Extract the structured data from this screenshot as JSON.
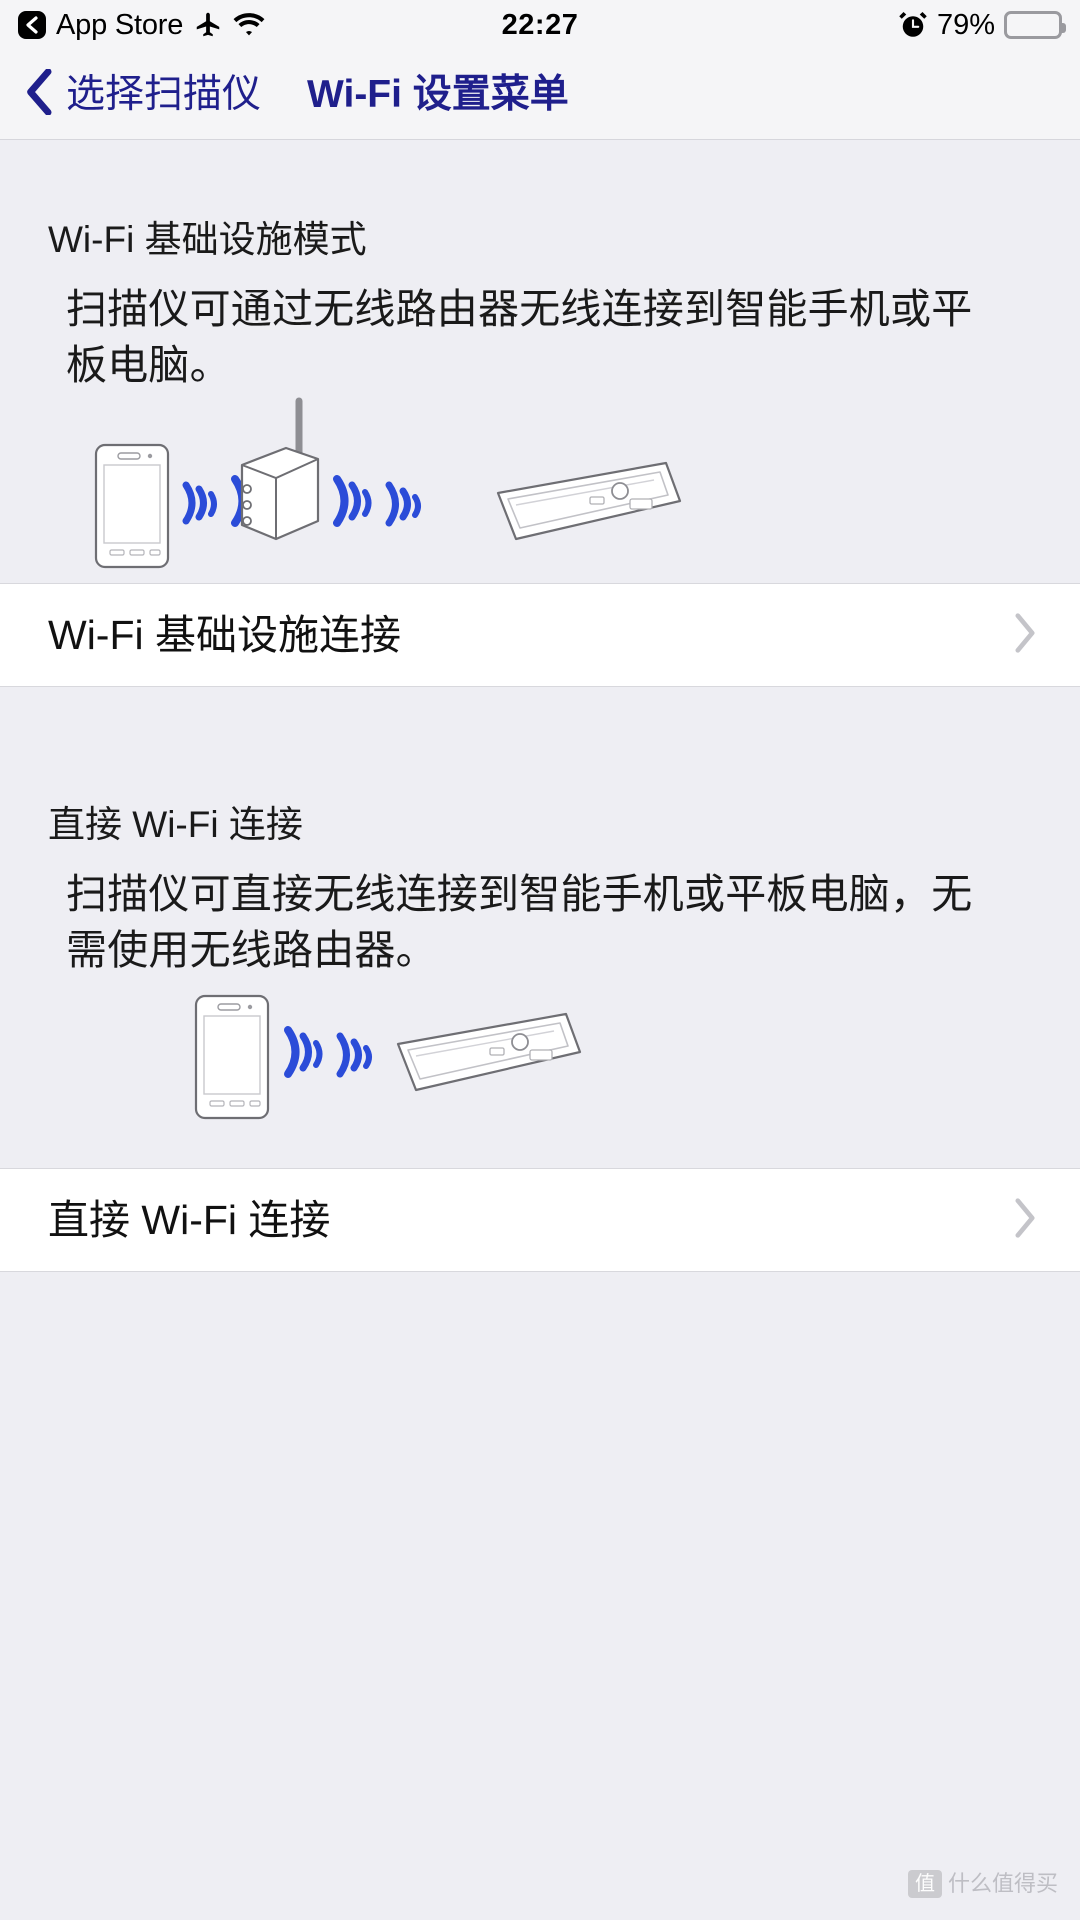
{
  "status_bar": {
    "back_app_label": "App Store",
    "back_badge_icon": "chevron-left-icon",
    "airplane_icon": "airplane-mode-icon",
    "wifi_icon": "wifi-icon",
    "time": "22:27",
    "alarm_icon": "alarm-clock-icon",
    "battery_percent_label": "79%",
    "battery_level": 79,
    "battery_icon": "battery-icon"
  },
  "nav_bar": {
    "back_icon": "chevron-left-icon",
    "back_label": "选择扫描仪",
    "title": "Wi-Fi 设置菜单",
    "accent_color": "#1f1f8c"
  },
  "sections": [
    {
      "heading": "Wi-Fi 基础设施模式",
      "body": "扫描仪可通过无线路由器无线连接到智能手机或平板电脑。",
      "illustration": "phone-router-scanner-diagram",
      "row": {
        "label": "Wi-Fi 基础设施连接",
        "chevron_icon": "chevron-right-icon"
      }
    },
    {
      "heading": "直接 Wi-Fi 连接",
      "body": "扫描仪可直接无线连接到智能手机或平板电脑，无需使用无线路由器。",
      "illustration": "phone-scanner-direct-diagram",
      "row": {
        "label": "直接 Wi-Fi 连接",
        "chevron_icon": "chevron-right-icon"
      }
    }
  ],
  "watermark": {
    "badge": "值",
    "text": "什么值得买"
  },
  "colors": {
    "page_background": "#eeeef3",
    "row_background": "#ffffff",
    "wifi_wave": "#2b4cd8",
    "nav_accent": "#1f1f8c",
    "chevron_gray": "#c4c4c9"
  }
}
